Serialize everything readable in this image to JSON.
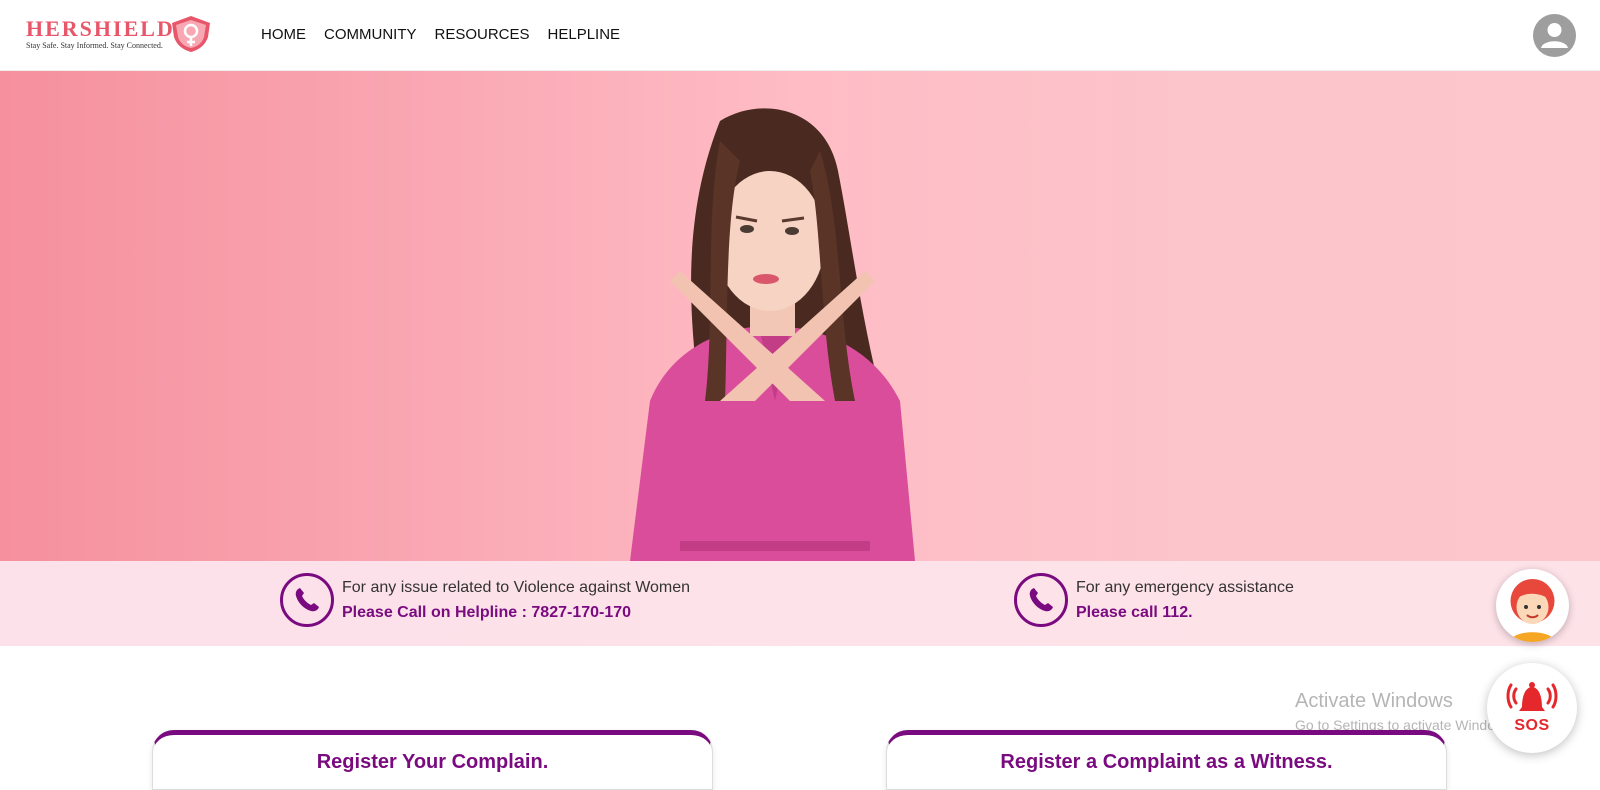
{
  "brand": {
    "name": "HERSHIELD",
    "tagline": "Stay Safe. Stay Informed. Stay Connected.",
    "accent": "#e8566a",
    "primary": "#7a0a7f"
  },
  "nav": {
    "items": [
      {
        "label": "HOME"
      },
      {
        "label": "COMMUNITY"
      },
      {
        "label": "RESOURCES"
      },
      {
        "label": "HELPLINE"
      }
    ]
  },
  "hero": {
    "image": "woman-crossing-arms-stop-gesture"
  },
  "helpline": {
    "left": {
      "line1": "For any issue related to Violence against Women",
      "line2": "Please Call on Helpline : 7827-170-170"
    },
    "right": {
      "line1": "For any emergency assistance",
      "line2": "Please call 112."
    }
  },
  "floating": {
    "chat_icon": "girl-avatar-icon",
    "sos_label": "SOS"
  },
  "watermark": {
    "title": "Activate Windows",
    "subtitle": "Go to Settings to activate Windows."
  },
  "cards": [
    {
      "title": "Register Your Complain."
    },
    {
      "title": "Register a Complaint as a Witness."
    }
  ]
}
